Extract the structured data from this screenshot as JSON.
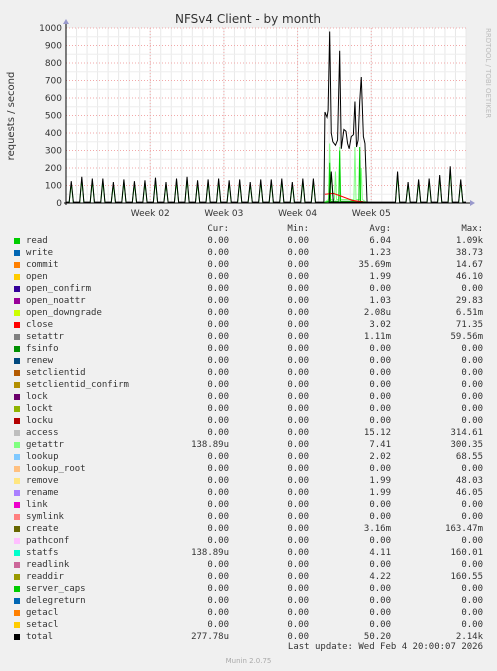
{
  "chart_data": {
    "type": "line",
    "title": "NFSv4 Client - by month",
    "ylabel": "requests / second",
    "watermark": "RRDTOOL / TOBI OETIKER",
    "ylim": [
      0,
      1000
    ],
    "y_ticks": [
      "0",
      "100",
      "200",
      "300",
      "400",
      "500",
      "600",
      "700",
      "800",
      "900",
      "1000"
    ],
    "x_ticks": [
      "Week 02",
      "Week 03",
      "Week 04",
      "Week 05"
    ],
    "grid": true,
    "x_range_days": [
      0,
      38
    ],
    "x_tick_days": [
      8,
      15,
      22,
      29
    ],
    "series_total": {
      "name": "total",
      "color": "#000000",
      "spikes": [
        {
          "day": 0.5,
          "v": 125
        },
        {
          "day": 1.5,
          "v": 150
        },
        {
          "day": 2.5,
          "v": 140
        },
        {
          "day": 3.5,
          "v": 140
        },
        {
          "day": 4.5,
          "v": 120
        },
        {
          "day": 5.5,
          "v": 135
        },
        {
          "day": 6.5,
          "v": 125
        },
        {
          "day": 7.5,
          "v": 130
        },
        {
          "day": 8.5,
          "v": 145
        },
        {
          "day": 9.5,
          "v": 120
        },
        {
          "day": 10.5,
          "v": 140
        },
        {
          "day": 11.5,
          "v": 150
        },
        {
          "day": 12.5,
          "v": 130
        },
        {
          "day": 13.5,
          "v": 135
        },
        {
          "day": 14.5,
          "v": 140
        },
        {
          "day": 15.5,
          "v": 130
        },
        {
          "day": 16.5,
          "v": 135
        },
        {
          "day": 17.5,
          "v": 120
        },
        {
          "day": 18.5,
          "v": 135
        },
        {
          "day": 19.5,
          "v": 135
        },
        {
          "day": 20.5,
          "v": 140
        },
        {
          "day": 21.5,
          "v": 120
        },
        {
          "day": 22.5,
          "v": 140
        },
        {
          "day": 23.5,
          "v": 140
        },
        {
          "day": 25.2,
          "v": 180
        },
        {
          "day": 31.5,
          "v": 180
        },
        {
          "day": 32.5,
          "v": 120
        },
        {
          "day": 33.5,
          "v": 135
        },
        {
          "day": 34.5,
          "v": 140
        },
        {
          "day": 35.5,
          "v": 160
        },
        {
          "day": 36.5,
          "v": 210
        },
        {
          "day": 37.5,
          "v": 135
        }
      ],
      "burst": [
        {
          "day": 24.5,
          "v": 5
        },
        {
          "day": 24.6,
          "v": 520
        },
        {
          "day": 24.8,
          "v": 490
        },
        {
          "day": 24.9,
          "v": 530
        },
        {
          "day": 25.05,
          "v": 980
        },
        {
          "day": 25.2,
          "v": 400
        },
        {
          "day": 25.35,
          "v": 350
        },
        {
          "day": 25.6,
          "v": 330
        },
        {
          "day": 25.8,
          "v": 360
        },
        {
          "day": 26.0,
          "v": 870
        },
        {
          "day": 26.15,
          "v": 310
        },
        {
          "day": 26.4,
          "v": 420
        },
        {
          "day": 26.6,
          "v": 410
        },
        {
          "day": 26.75,
          "v": 340
        },
        {
          "day": 26.9,
          "v": 310
        },
        {
          "day": 27.1,
          "v": 380
        },
        {
          "day": 27.3,
          "v": 390
        },
        {
          "day": 27.45,
          "v": 580
        },
        {
          "day": 27.6,
          "v": 320
        },
        {
          "day": 27.75,
          "v": 360
        },
        {
          "day": 27.9,
          "v": 580
        },
        {
          "day": 28.05,
          "v": 720
        },
        {
          "day": 28.25,
          "v": 380
        },
        {
          "day": 28.4,
          "v": 340
        },
        {
          "day": 28.6,
          "v": 5
        }
      ],
      "baseline": 5
    },
    "series_getattr_peaks": [
      {
        "day": 25.05,
        "v": 340
      },
      {
        "day": 25.6,
        "v": 180
      },
      {
        "day": 26.0,
        "v": 320
      },
      {
        "day": 27.45,
        "v": 320
      },
      {
        "day": 28.05,
        "v": 200
      }
    ],
    "series_read_peaks": [
      {
        "day": 25.05,
        "v": 230
      },
      {
        "day": 26.0,
        "v": 300
      },
      {
        "day": 27.9,
        "v": 320
      }
    ],
    "series_close_level": [
      {
        "day": 24.6,
        "v": 50
      },
      {
        "day": 25.4,
        "v": 55
      },
      {
        "day": 26.1,
        "v": 40
      },
      {
        "day": 27.2,
        "v": 15
      },
      {
        "day": 28.4,
        "v": 5
      }
    ],
    "columns": {
      "cur": "Cur:",
      "min": "Min:",
      "avg": "Avg:",
      "max": "Max:"
    },
    "legend": [
      {
        "name": "read",
        "color": "#00cc00",
        "cur": "0.00",
        "min": "0.00",
        "avg": "6.04",
        "max": "1.09k"
      },
      {
        "name": "write",
        "color": "#0066b3",
        "cur": "0.00",
        "min": "0.00",
        "avg": "1.23",
        "max": "38.73"
      },
      {
        "name": "commit",
        "color": "#ff8000",
        "cur": "0.00",
        "min": "0.00",
        "avg": "35.69m",
        "max": "14.67"
      },
      {
        "name": "open",
        "color": "#ffcc00",
        "cur": "0.00",
        "min": "0.00",
        "avg": "1.99",
        "max": "46.10"
      },
      {
        "name": "open_confirm",
        "color": "#330099",
        "cur": "0.00",
        "min": "0.00",
        "avg": "0.00",
        "max": "0.00"
      },
      {
        "name": "open_noattr",
        "color": "#990099",
        "cur": "0.00",
        "min": "0.00",
        "avg": "1.03",
        "max": "29.83"
      },
      {
        "name": "open_downgrade",
        "color": "#ccff00",
        "cur": "0.00",
        "min": "0.00",
        "avg": "2.08u",
        "max": "6.51m"
      },
      {
        "name": "close",
        "color": "#ff0000",
        "cur": "0.00",
        "min": "0.00",
        "avg": "3.02",
        "max": "71.35"
      },
      {
        "name": "setattr",
        "color": "#808080",
        "cur": "0.00",
        "min": "0.00",
        "avg": "1.11m",
        "max": "59.56m"
      },
      {
        "name": "fsinfo",
        "color": "#008f00",
        "cur": "0.00",
        "min": "0.00",
        "avg": "0.00",
        "max": "0.00"
      },
      {
        "name": "renew",
        "color": "#00487d",
        "cur": "0.00",
        "min": "0.00",
        "avg": "0.00",
        "max": "0.00"
      },
      {
        "name": "setclientid",
        "color": "#b35a00",
        "cur": "0.00",
        "min": "0.00",
        "avg": "0.00",
        "max": "0.00"
      },
      {
        "name": "setclientid_confirm",
        "color": "#b38f00",
        "cur": "0.00",
        "min": "0.00",
        "avg": "0.00",
        "max": "0.00"
      },
      {
        "name": "lock",
        "color": "#6b006b",
        "cur": "0.00",
        "min": "0.00",
        "avg": "0.00",
        "max": "0.00"
      },
      {
        "name": "lockt",
        "color": "#8fb300",
        "cur": "0.00",
        "min": "0.00",
        "avg": "0.00",
        "max": "0.00"
      },
      {
        "name": "locku",
        "color": "#b30000",
        "cur": "0.00",
        "min": "0.00",
        "avg": "0.00",
        "max": "0.00"
      },
      {
        "name": "access",
        "color": "#bebebe",
        "cur": "0.00",
        "min": "0.00",
        "avg": "15.12",
        "max": "314.61"
      },
      {
        "name": "getattr",
        "color": "#80ff80",
        "cur": "138.89u",
        "min": "0.00",
        "avg": "7.41",
        "max": "300.35"
      },
      {
        "name": "lookup",
        "color": "#80c9ff",
        "cur": "0.00",
        "min": "0.00",
        "avg": "2.02",
        "max": "68.55"
      },
      {
        "name": "lookup_root",
        "color": "#ffc080",
        "cur": "0.00",
        "min": "0.00",
        "avg": "0.00",
        "max": "0.00"
      },
      {
        "name": "remove",
        "color": "#ffe680",
        "cur": "0.00",
        "min": "0.00",
        "avg": "1.99",
        "max": "48.03"
      },
      {
        "name": "rename",
        "color": "#aa80ff",
        "cur": "0.00",
        "min": "0.00",
        "avg": "1.99",
        "max": "46.05"
      },
      {
        "name": "link",
        "color": "#ee00cc",
        "cur": "0.00",
        "min": "0.00",
        "avg": "0.00",
        "max": "0.00"
      },
      {
        "name": "symlink",
        "color": "#ff8080",
        "cur": "0.00",
        "min": "0.00",
        "avg": "0.00",
        "max": "0.00"
      },
      {
        "name": "create",
        "color": "#666600",
        "cur": "0.00",
        "min": "0.00",
        "avg": "3.16m",
        "max": "163.47m"
      },
      {
        "name": "pathconf",
        "color": "#ffbfff",
        "cur": "0.00",
        "min": "0.00",
        "avg": "0.00",
        "max": "0.00"
      },
      {
        "name": "statfs",
        "color": "#00ffcc",
        "cur": "138.89u",
        "min": "0.00",
        "avg": "4.11",
        "max": "160.01"
      },
      {
        "name": "readlink",
        "color": "#cc6699",
        "cur": "0.00",
        "min": "0.00",
        "avg": "0.00",
        "max": "0.00"
      },
      {
        "name": "readdir",
        "color": "#999900",
        "cur": "0.00",
        "min": "0.00",
        "avg": "4.22",
        "max": "160.55"
      },
      {
        "name": "server_caps",
        "color": "#00cc00",
        "cur": "0.00",
        "min": "0.00",
        "avg": "0.00",
        "max": "0.00"
      },
      {
        "name": "delegreturn",
        "color": "#0066b3",
        "cur": "0.00",
        "min": "0.00",
        "avg": "0.00",
        "max": "0.00"
      },
      {
        "name": "getacl",
        "color": "#ff8000",
        "cur": "0.00",
        "min": "0.00",
        "avg": "0.00",
        "max": "0.00"
      },
      {
        "name": "setacl",
        "color": "#ffcc00",
        "cur": "0.00",
        "min": "0.00",
        "avg": "0.00",
        "max": "0.00"
      },
      {
        "name": "total",
        "color": "#000000",
        "cur": "277.78u",
        "min": "0.00",
        "avg": "50.20",
        "max": "2.14k"
      }
    ]
  },
  "footer": {
    "last_update": "Last update: Wed Feb  4 20:00:07 2026",
    "version": "Munin 2.0.75"
  }
}
